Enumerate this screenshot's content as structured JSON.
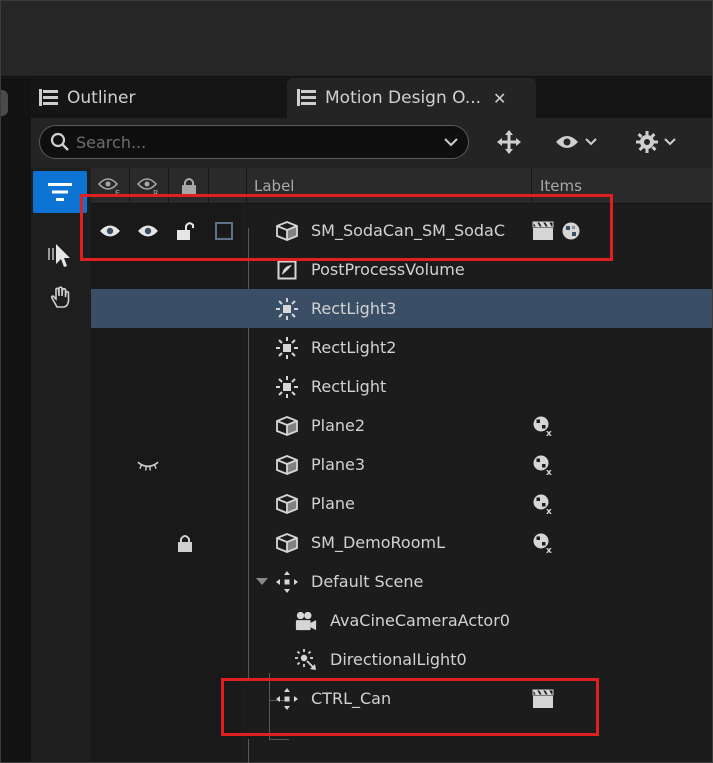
{
  "tabs": [
    {
      "label": "Outliner"
    },
    {
      "label": "Motion Design O..."
    }
  ],
  "search": {
    "placeholder": "Search..."
  },
  "columns": {
    "label": "Label",
    "items": "Items"
  },
  "rows": [
    {
      "label": "SM_SodaCan_SM_SodaC",
      "icon": "static-mesh-icon",
      "selected": true,
      "items": [
        "clapper-icon",
        "material-icon"
      ]
    },
    {
      "label": "PostProcessVolume",
      "icon": "post-process-icon"
    },
    {
      "label": "RectLight3",
      "icon": "rect-light-icon"
    },
    {
      "label": "RectLight2",
      "icon": "rect-light-icon"
    },
    {
      "label": "RectLight",
      "icon": "rect-light-icon"
    },
    {
      "label": "Plane2",
      "icon": "static-mesh-icon",
      "items": [
        "material-x-icon"
      ]
    },
    {
      "label": "Plane3",
      "icon": "static-mesh-icon",
      "hidden": true,
      "items": [
        "material-x-icon"
      ]
    },
    {
      "label": "Plane",
      "icon": "static-mesh-icon",
      "items": [
        "material-x-icon"
      ]
    },
    {
      "label": "SM_DemoRoomL",
      "icon": "static-mesh-icon",
      "locked": true,
      "items": [
        "material-x-icon"
      ]
    },
    {
      "label": "Default Scene",
      "icon": "scene-move-icon",
      "expanded": true
    },
    {
      "label": "AvaCineCameraActor0",
      "icon": "camera-icon"
    },
    {
      "label": "DirectionalLight0",
      "icon": "directional-light-icon"
    },
    {
      "label": "CTRL_Can",
      "icon": "scene-move-icon",
      "items": [
        "clapper-icon"
      ]
    }
  ],
  "colors": {
    "selected_row": "#3a4f66",
    "filter_button": "#0e74d3",
    "highlight_box": "#e02020"
  }
}
